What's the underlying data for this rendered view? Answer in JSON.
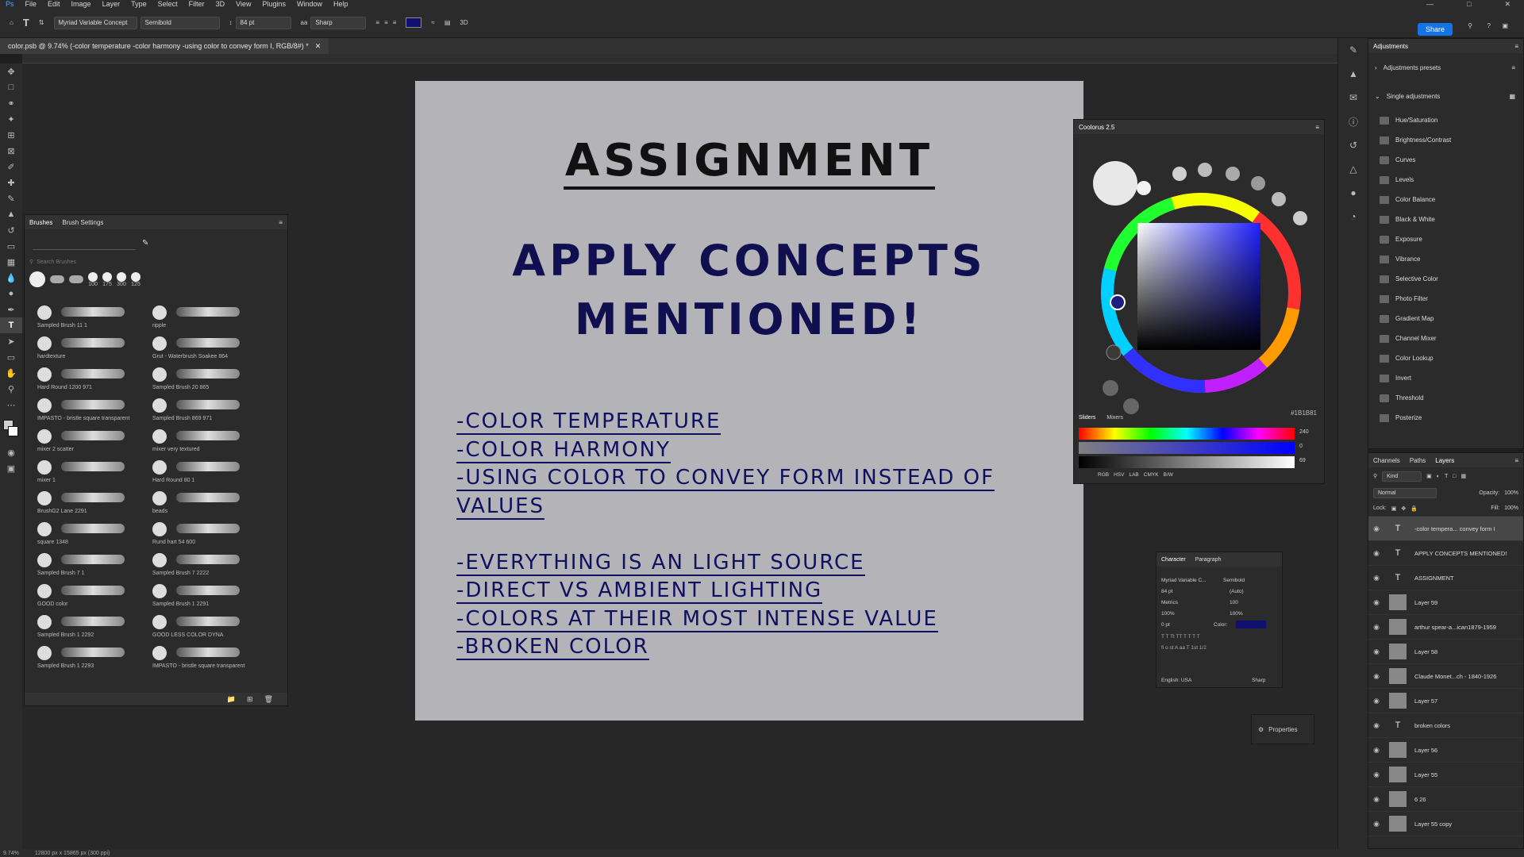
{
  "menubar": {
    "items": [
      "File",
      "Edit",
      "Image",
      "Layer",
      "Type",
      "Select",
      "Filter",
      "3D",
      "View",
      "Plugins",
      "Window",
      "Help"
    ]
  },
  "options": {
    "font_family": "Myriad Variable Concept",
    "font_style": "Semibold",
    "font_size": "84 pt",
    "aa_label": "aa",
    "antialias": "Sharp",
    "color_swatch": "#101070",
    "share_label": "Share"
  },
  "document": {
    "tab_title": "color.psb @ 9.74% (-color temperature -color harmony -using color to convey form I, RGB/8#) *"
  },
  "artboard": {
    "title": "ASSIGNMENT",
    "subtitle_line1": "APPLY CONCEPTS",
    "subtitle_line2": "MENTIONED!",
    "bullets": [
      "-COLOR TEMPERATURE",
      "-COLOR HARMONY",
      "-USING COLOR TO CONVEY FORM INSTEAD OF",
      "VALUES",
      "",
      "-EVERYTHING IS AN LIGHT SOURCE",
      "-DIRECT VS AMBIENT LIGHTING",
      "-COLORS AT THEIR MOST INTENSE VALUE",
      "-BROKEN COLOR"
    ]
  },
  "brushes": {
    "tabs": [
      "Brushes",
      "Brush Settings"
    ],
    "search_placeholder": "Search Brushes",
    "sizes": [
      "100",
      "175",
      "300",
      "125"
    ],
    "items": [
      "Sampled Brush 11 1",
      "ripple",
      "hardtexture",
      "Grut - Waterbrush Soakee 864",
      "Hard Round 1200 971",
      "Sampled Brush 20 865",
      "IMPASTO - bristle square transparent",
      "Sampled Brush 869 971",
      "mixer 2 scatter",
      "mixer very textured",
      "mixer 1",
      "Hard Round 80 1",
      "BrushG2 Lane 2291",
      "beads",
      "square 1348",
      "Rund hart 54 600",
      "Sampled Brush 7 1",
      "Sampled Brush 7 2222",
      "GOOD color",
      "Sampled Brush 1 2291",
      "Sampled Brush 1 2292",
      "GOOD LESS COLOR DYNA",
      "Sampled Brush 1 2293",
      "IMPASTO - bristle square transparent"
    ]
  },
  "coolorus": {
    "title": "Coolorus 2.5",
    "hex": "#1B1B81",
    "tabs": [
      "Sliders",
      "Mixers"
    ],
    "slider_values": [
      "240",
      "0",
      "69"
    ],
    "modes": [
      "RGB",
      "HSV",
      "LAB",
      "CMYK",
      "B/W"
    ]
  },
  "character": {
    "tabs": [
      "Character",
      "Paragraph"
    ],
    "font": "Myriad Variable C...",
    "style": "Semibold",
    "size": "84 pt",
    "leading": "(Auto)",
    "kerning": "Metrics",
    "tracking": "100",
    "vscale": "100%",
    "hscale": "100%",
    "baseline": "0 pt",
    "color_label": "Color:",
    "language": "English: USA",
    "aa": "Sharp"
  },
  "properties": {
    "label": "Properties"
  },
  "adjustments": {
    "title": "Adjustments",
    "presets": "Adjustments presets",
    "single": "Single adjustments",
    "items": [
      "Hue/Saturation",
      "Brightness/Contrast",
      "Curves",
      "Levels",
      "Color Balance",
      "Black & White",
      "Exposure",
      "Vibrance",
      "Selective Color",
      "Photo Filter",
      "Gradient Map",
      "Channel Mixer",
      "Color Lookup",
      "Invert",
      "Threshold",
      "Posterize"
    ]
  },
  "layers_panel": {
    "tabs": [
      "Channels",
      "Paths",
      "Layers"
    ],
    "kind": "Kind",
    "blend": "Normal",
    "opacity_label": "Opacity:",
    "opacity": "100%",
    "lock_label": "Lock:",
    "fill_label": "Fill:",
    "fill": "100%",
    "layers": [
      {
        "name": "-color tempera... convey form I",
        "type": "T"
      },
      {
        "name": "APPLY CONCEPTS MENTIONED!",
        "type": "T"
      },
      {
        "name": "ASSIGNMENT",
        "type": "T"
      },
      {
        "name": "Layer 59",
        "type": "img"
      },
      {
        "name": "arthur spear-a...ican1879-1959",
        "type": "img"
      },
      {
        "name": "Layer 58",
        "type": "img"
      },
      {
        "name": "Claude Monet...ch - 1840-1926",
        "type": "img"
      },
      {
        "name": "Layer 57",
        "type": "img"
      },
      {
        "name": "broken colors",
        "type": "T"
      },
      {
        "name": "Layer 56",
        "type": "img"
      },
      {
        "name": "Layer 55",
        "type": "img"
      },
      {
        "name": "6 26",
        "type": "img"
      },
      {
        "name": "Layer 55 copy",
        "type": "img"
      }
    ]
  },
  "status": {
    "zoom": "9.74%",
    "dims": "12800 px x 15865 px (300 ppi)"
  }
}
